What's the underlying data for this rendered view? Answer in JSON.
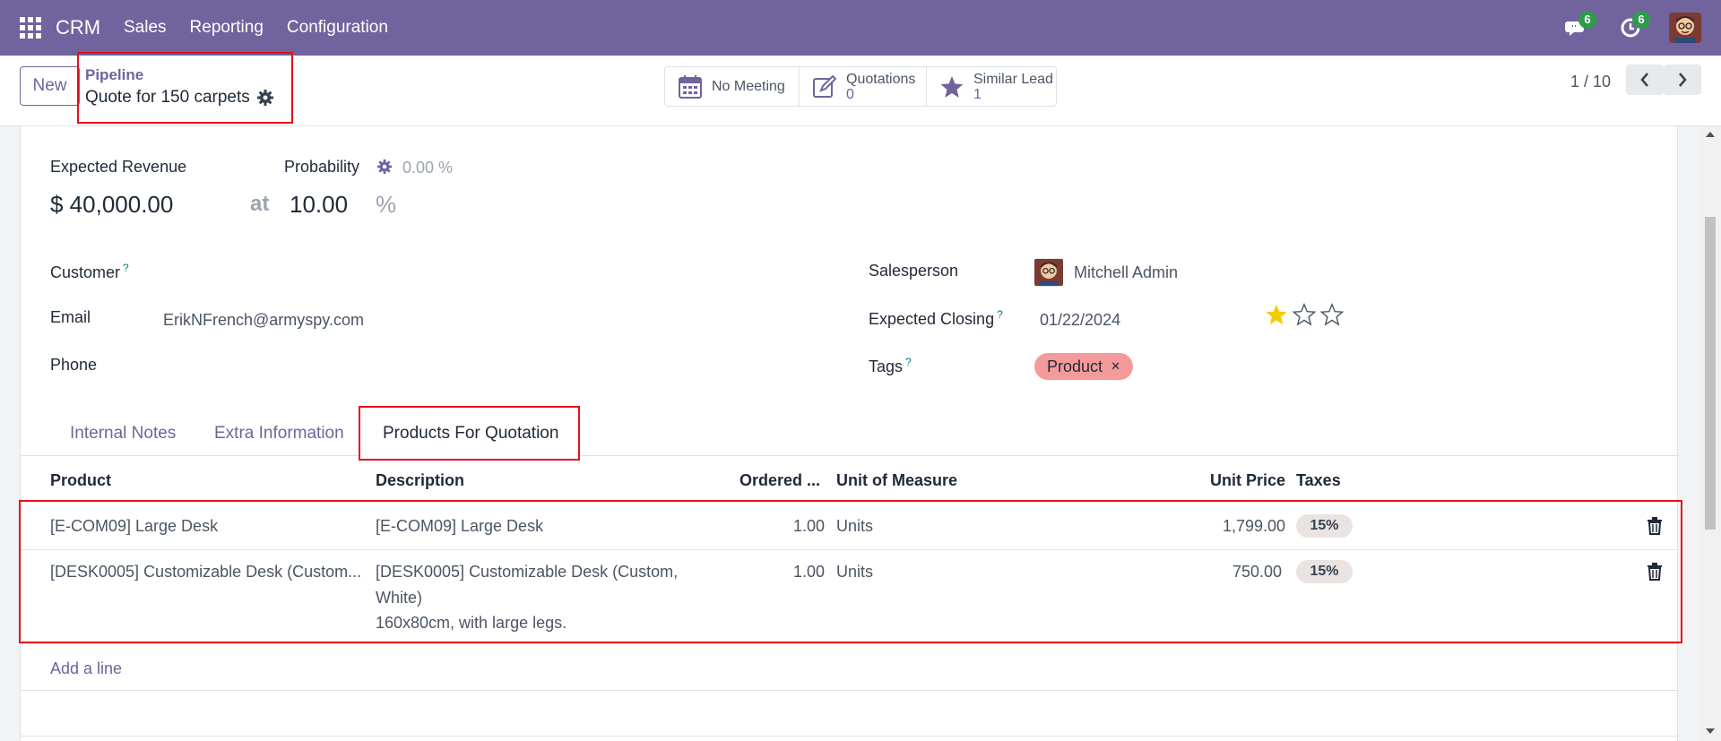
{
  "navbar": {
    "brand": "CRM",
    "menu": [
      "Sales",
      "Reporting",
      "Configuration"
    ],
    "messages_badge": "6",
    "activities_badge": "6"
  },
  "control": {
    "new_label": "New",
    "breadcrumb_parent": "Pipeline",
    "record_title": "Quote for 150 carpets",
    "smart_buttons": [
      {
        "label": "No Meeting",
        "count": ""
      },
      {
        "label": "Quotations",
        "count": "0"
      },
      {
        "label": "Similar Lead",
        "count": "1"
      }
    ],
    "pager": "1 / 10"
  },
  "form": {
    "expected_revenue_label": "Expected Revenue",
    "expected_revenue_value": "$ 40,000.00",
    "probability_label": "Probability",
    "probability_auto": "0.00 %",
    "at_label": "at",
    "probability_value": "10.00",
    "percent_sign": "%",
    "customer_label": "Customer",
    "email_label": "Email",
    "email_value": "ErikNFrench@armyspy.com",
    "phone_label": "Phone",
    "salesperson_label": "Salesperson",
    "salesperson_value": "Mitchell Admin",
    "expected_closing_label": "Expected Closing",
    "expected_closing_value": "01/22/2024",
    "priority_stars": 1,
    "tags_label": "Tags",
    "tag_value": "Product",
    "help_mark": "?"
  },
  "tabs": [
    "Internal Notes",
    "Extra Information",
    "Products For Quotation"
  ],
  "table": {
    "headers": [
      "Product",
      "Description",
      "Ordered ...",
      "Unit of Measure",
      "Unit Price",
      "Taxes"
    ],
    "rows": [
      {
        "product": "[E-COM09] Large Desk",
        "description": [
          "[E-COM09] Large Desk"
        ],
        "qty": "1.00",
        "uom": "Units",
        "price": "1,799.00",
        "tax": "15%"
      },
      {
        "product": "[DESK0005] Customizable Desk (Custom...",
        "description": [
          "[DESK0005] Customizable Desk (Custom,",
          "White)",
          "160x80cm, with large legs."
        ],
        "qty": "1.00",
        "uom": "Units",
        "price": "750.00",
        "tax": "15%"
      }
    ],
    "add_line": "Add a line"
  },
  "colors": {
    "navbar": "#71639e",
    "accent": "#71639e",
    "highlight_border": "#e3101b",
    "tag_bg": "#f59a9a",
    "star": "#f3cc00"
  }
}
